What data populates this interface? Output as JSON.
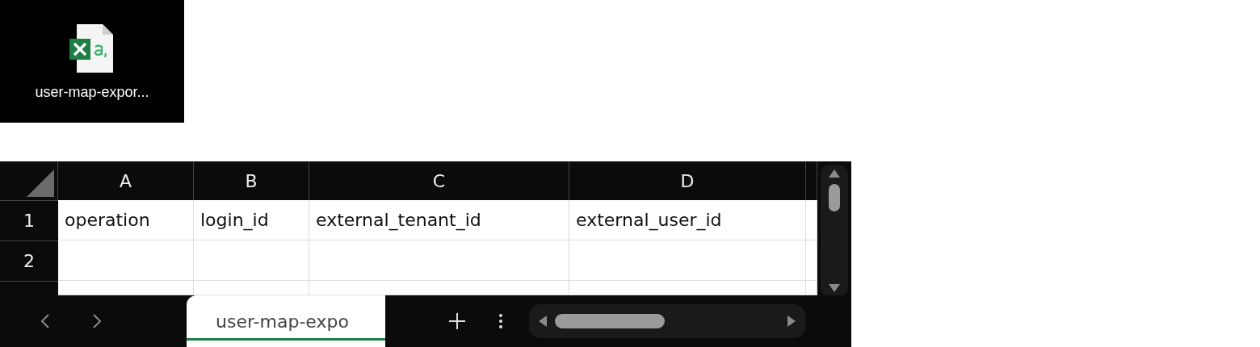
{
  "desktop_icon": {
    "label": "user-map-expor..."
  },
  "sheet": {
    "columns": [
      "A",
      "B",
      "C",
      "D"
    ],
    "rows": [
      {
        "number": "1",
        "cells": [
          "operation",
          "login_id",
          "external_tenant_id",
          "external_user_id"
        ]
      },
      {
        "number": "2"
      }
    ],
    "tabs": [
      {
        "label": "user-map-expo",
        "selected": true
      }
    ]
  }
}
